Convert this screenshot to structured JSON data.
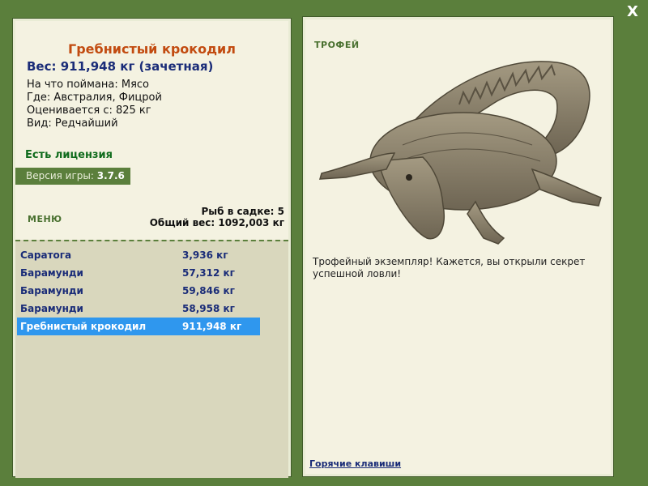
{
  "close_label": "X",
  "left": {
    "title": "Гребнистый крокодил",
    "weight": "Вес: 911,948 кг (зачетная)",
    "bait": "На что поймана: Мясо",
    "where": "Где: Австралия, Фицрой",
    "valued": "Оценивается с: 825 кг",
    "kind": "Вид: Редчайший",
    "license": "Есть лицензия",
    "version_label": "Версия игры:",
    "version_value": "3.7.6",
    "menu": "МЕНЮ",
    "fish_count": "Рыб в садке: 5",
    "total_weight": "Общий вес: 1092,003 кг",
    "catch_list": [
      {
        "name": "Саратога",
        "weight": "3,936 кг"
      },
      {
        "name": "Барамунди",
        "weight": "57,312 кг"
      },
      {
        "name": "Барамунди",
        "weight": "59,846 кг"
      },
      {
        "name": "Барамунди",
        "weight": "58,958 кг"
      },
      {
        "name": "Гребнистый крокодил",
        "weight": "911,948 кг"
      }
    ]
  },
  "right": {
    "trophy_label": "ТРОФЕЙ",
    "image": "crocodile-trophy",
    "description": "Трофейный экземпляр! Кажется, вы открыли секрет успешной ловли!",
    "hotkeys": "Горячие клавиши"
  },
  "colors": {
    "background": "#5b7f3c",
    "panel": "#f4f2e1",
    "title": "#c24b10",
    "weight": "#1a2c78",
    "license": "#0f6b1c",
    "selected_row": "#2f97ee"
  }
}
